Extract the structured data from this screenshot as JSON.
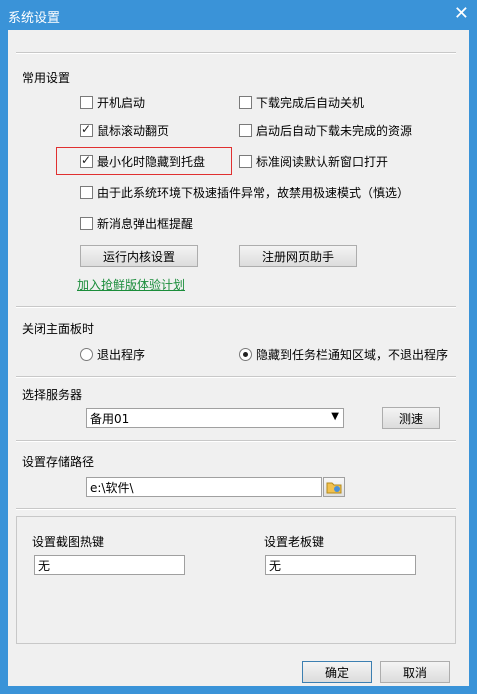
{
  "window": {
    "title": "系统设置",
    "close_glyph": "✕"
  },
  "common": {
    "label": "常用设置",
    "options": [
      {
        "label": "开机启动",
        "checked": false
      },
      {
        "label": "下载完成后自动关机",
        "checked": false
      },
      {
        "label": "鼠标滚动翻页",
        "checked": true
      },
      {
        "label": "启动后自动下载未完成的资源",
        "checked": false
      },
      {
        "label": "最小化时隐藏到托盘",
        "checked": true
      },
      {
        "label": "标准阅读默认新窗口打开",
        "checked": false
      },
      {
        "label": "由于此系统环境下极速插件异常，故禁用极速模式（慎选）",
        "checked": false
      },
      {
        "label": "新消息弹出框提醒",
        "checked": false
      }
    ],
    "kernel_button": "运行内核设置",
    "register_button": "注册网页助手",
    "join_link": "加入抢鲜版体验计划"
  },
  "close_panel": {
    "label": "关闭主面板时",
    "options": [
      {
        "label": "退出程序",
        "selected": false
      },
      {
        "label": "隐藏到任务栏通知区域，不退出程序",
        "selected": true
      }
    ]
  },
  "server": {
    "label": "选择服务器",
    "selected": "备用01",
    "test_button": "测速"
  },
  "storage": {
    "label": "设置存储路径",
    "path": "e:\\软件\\"
  },
  "hotkeys": {
    "screenshot_label": "设置截图热键",
    "screenshot_value": "无",
    "boss_label": "设置老板键",
    "boss_value": "无"
  },
  "footer": {
    "ok": "确定",
    "cancel": "取消"
  },
  "colors": {
    "titlebar": "#3a93d8",
    "link": "#1b8d3b",
    "highlight": "#e03030"
  }
}
